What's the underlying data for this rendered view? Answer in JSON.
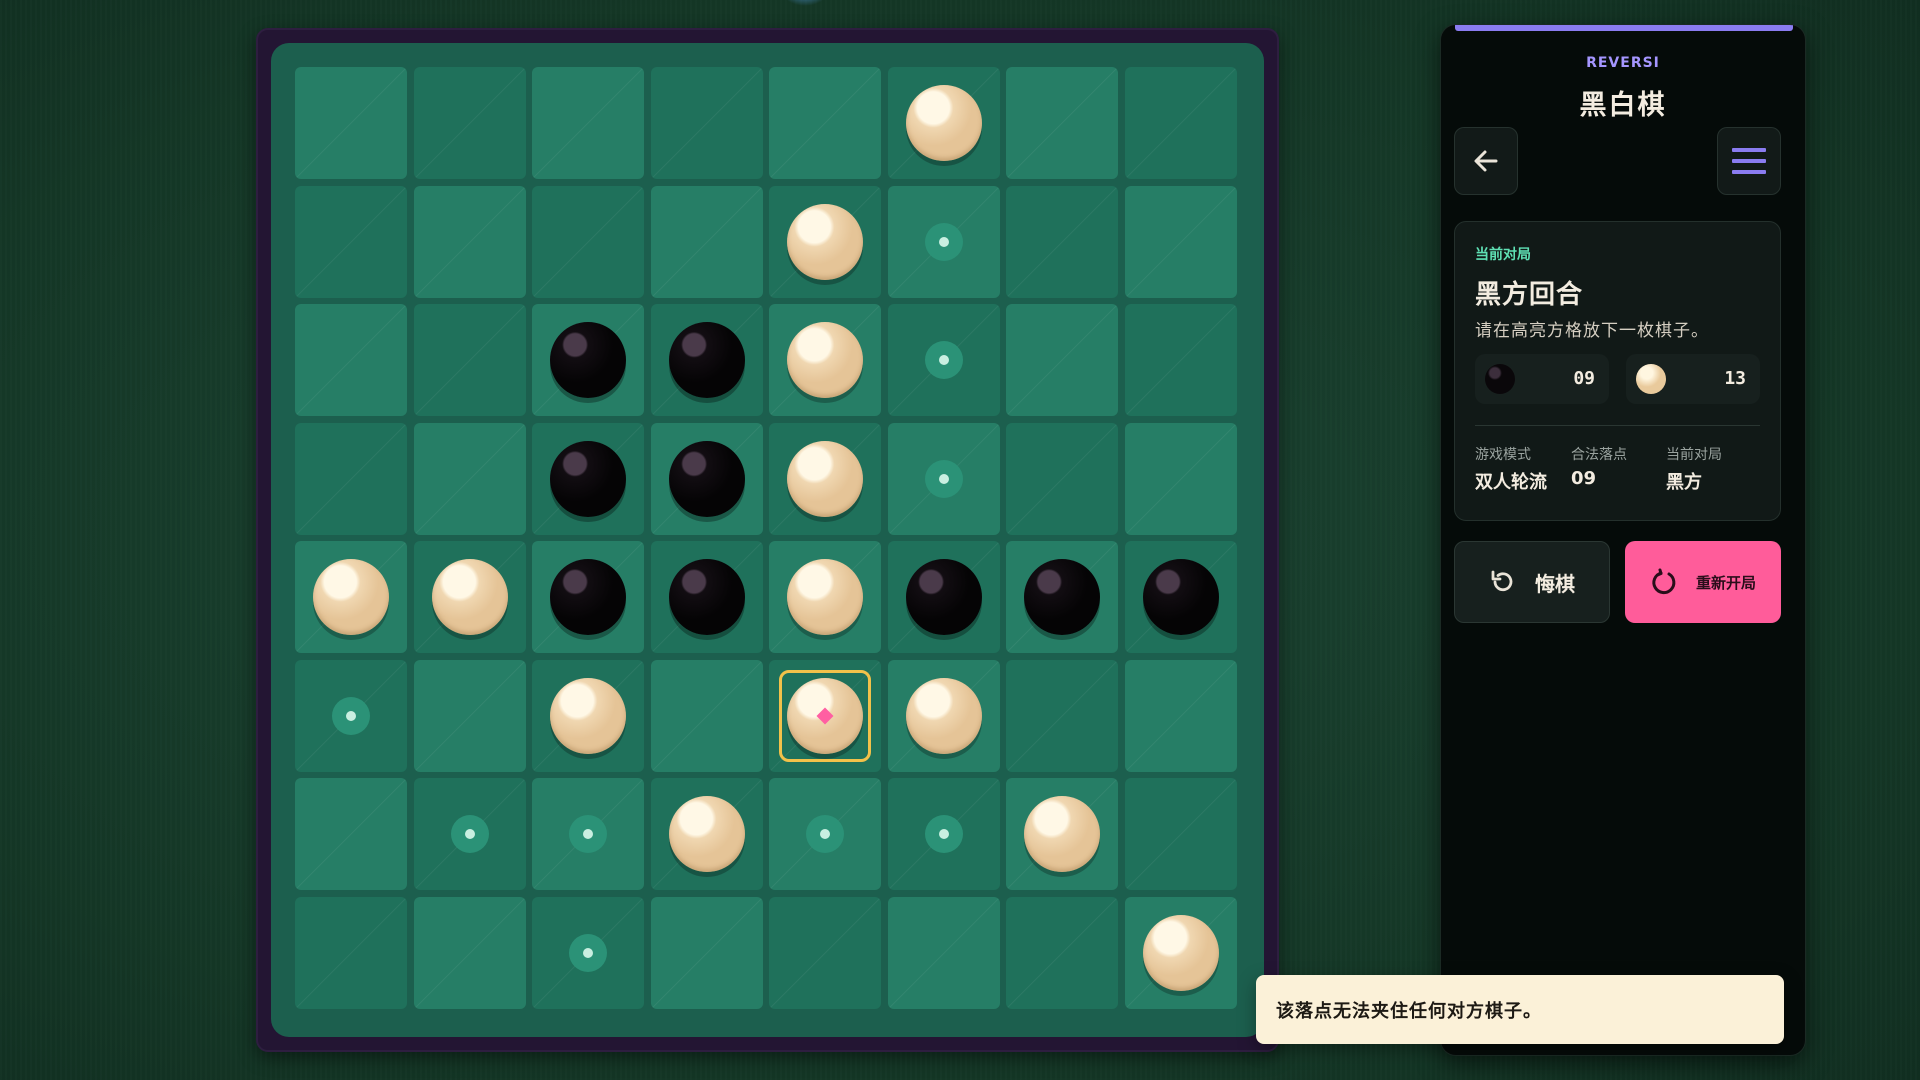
{
  "panel": {
    "subtitle": "REVERSI",
    "title": "黑白棋",
    "back_icon": "arrow-left-icon",
    "menu_icon": "hamburger-menu-icon"
  },
  "game": {
    "section_label": "当前对局",
    "turn": "黑方回合",
    "message": "请在高亮方格放下一枚棋子。",
    "black_score": "09",
    "white_score": "13",
    "stats": [
      {
        "label": "游戏模式",
        "value": "双人轮流"
      },
      {
        "label": "合法落点",
        "value": "09"
      },
      {
        "label": "当前对局",
        "value": "黑方"
      }
    ]
  },
  "buttons": {
    "undo": "悔棋",
    "restart": "重新开局"
  },
  "toast": "该落点无法夹住任何对方棋子。",
  "board": {
    "rows": [
      ". . . . . W . .",
      ". . . . W * . .",
      ". . B B W * . .",
      ". . B B W * . .",
      "W W B B W B B B",
      "* . W . W W . .",
      ". * * W * * W .",
      ". . * . . . . W"
    ],
    "selected": [
      5,
      4
    ]
  },
  "colors": {
    "accent": "#8a7cf0",
    "restart": "#ff5c9a",
    "highlight": "#f2c14a",
    "label": "#5fe0b4"
  }
}
